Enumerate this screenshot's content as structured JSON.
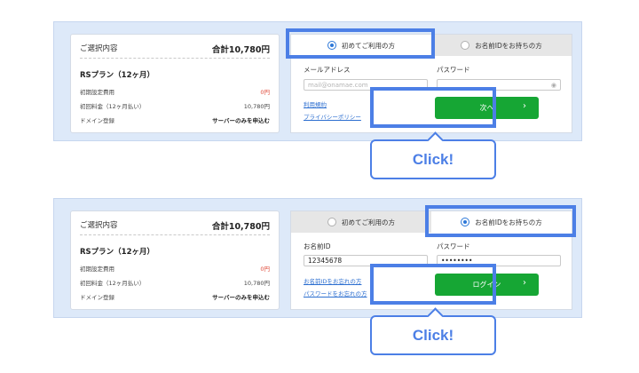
{
  "colors": {
    "accent": "#4c7fe6",
    "button": "#16a634",
    "link": "#2d6fd0",
    "price_red": "#e04a3a",
    "panel_bg": "#dde9f9"
  },
  "summary": {
    "title": "ご選択内容",
    "total": "合計10,780円",
    "plan": "RSプラン（12ヶ月）",
    "rows": [
      {
        "label": "初期設定費用",
        "value": "0円"
      },
      {
        "label": "初回料金（12ヶ月払い）",
        "value": "10,780円"
      },
      {
        "label": "ドメイン登録",
        "value": "サーバーのみを申込む"
      }
    ]
  },
  "step1": {
    "tab_new": "初めてご利用の方",
    "tab_existing": "お名前IDをお持ちの方",
    "email_label": "メールアドレス",
    "email_placeholder": "mail@onamae.com",
    "password_label": "パスワード",
    "link_terms": "利用規約",
    "link_privacy": "プライバシーポリシー",
    "button": "次へ",
    "callout": "Click!",
    "eye_icon": "eye-icon"
  },
  "step2": {
    "tab_new": "初めてご利用の方",
    "tab_existing": "お名前IDをお持ちの方",
    "id_label": "お名前ID",
    "id_value": "12345678",
    "password_label": "パスワード",
    "password_value": "••••••••",
    "link_forgot_id": "お名前IDをお忘れの方",
    "link_forgot_password": "パスワードをお忘れの方",
    "button": "ログイン",
    "callout": "Click!"
  }
}
